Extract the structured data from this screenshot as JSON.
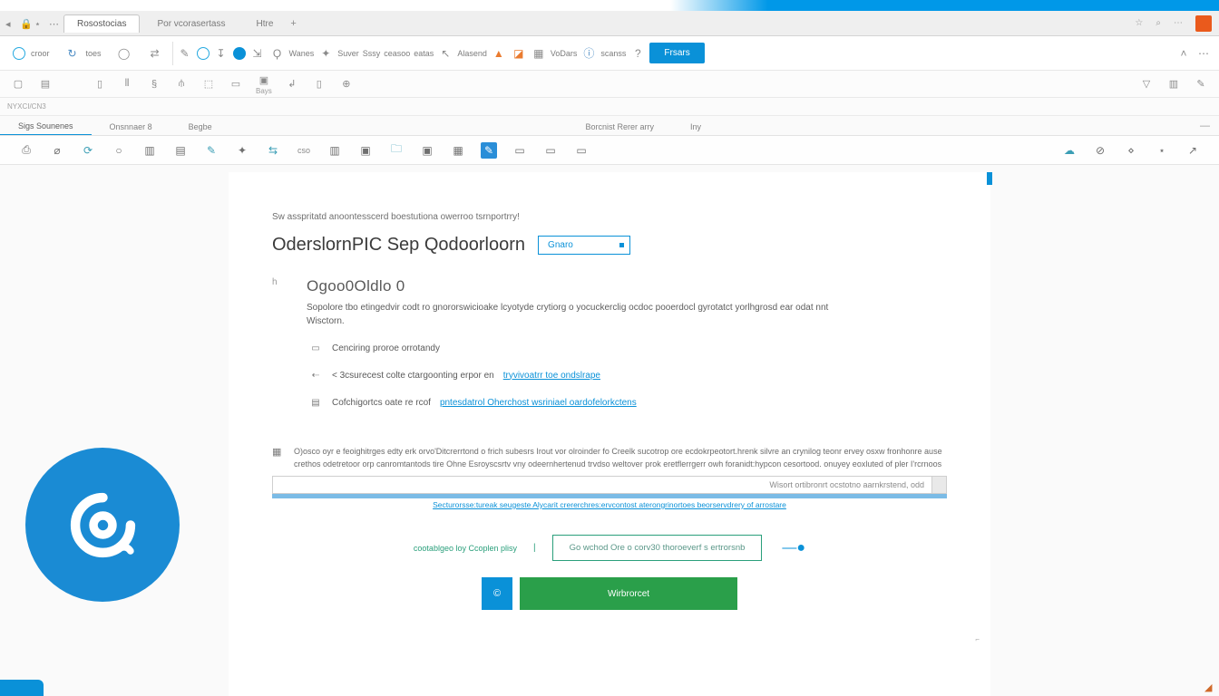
{
  "tabs": {
    "items": [
      "Rosostocias",
      "Por vcorasertass",
      "Htre"
    ],
    "activeIndex": 0,
    "rightIcons": [
      "☆",
      "⌕",
      "⋯"
    ]
  },
  "ribbon": {
    "groups": [
      {
        "icon": "◎",
        "sublabel": "croor"
      },
      {
        "icon": "↻",
        "sublabel": "toes"
      },
      {
        "icon": "◯",
        "sublabel": ""
      },
      {
        "icon": "⇄",
        "sublabel": ""
      }
    ],
    "mid": [
      {
        "icon": "✎"
      },
      {
        "icon": "○"
      },
      {
        "icon": "↧"
      },
      {
        "icon": "●",
        "cls": "blue-fill"
      },
      {
        "icon": "⇲"
      },
      {
        "icon": "Ϙ"
      }
    ],
    "labeled": [
      {
        "label": "Wanes"
      },
      {
        "icon": "✦"
      },
      {
        "label": "Suver"
      },
      {
        "label": "Sssy"
      },
      {
        "label": "ceasoo"
      },
      {
        "label": "eatas"
      },
      {
        "icon": "↖"
      },
      {
        "label": "Alasend"
      },
      {
        "icon": "▲",
        "cls": "orange"
      },
      {
        "icon": "◪",
        "cls": "orange"
      },
      {
        "icon": "▦"
      },
      {
        "label": "VoDars"
      },
      {
        "icon": "ⓘ"
      },
      {
        "label": "scanss"
      },
      {
        "icon": "?"
      }
    ],
    "primary": "Frsars"
  },
  "second_row": {
    "left": [
      "▢",
      "▤",
      "",
      "▯",
      "⫴",
      "§",
      "⫛",
      "⬚",
      "▭",
      "▣"
    ],
    "sublabel": "Bays",
    "mid": [
      "↲",
      "▯",
      "⊕"
    ],
    "right": [
      "▽",
      "",
      "▥",
      "✎"
    ]
  },
  "catrow": "NYXCI/CN3",
  "subtabs": {
    "left": [
      "Sigs Sounenes",
      "Onsnnaer 8",
      "Begbe"
    ],
    "right": [
      "Borcnist Rerer arry",
      "Iny"
    ],
    "activeIndex": 0
  },
  "fmt_icons": [
    "⎙",
    "⌀",
    "⟳",
    "○",
    "▥",
    "▤",
    "⬚",
    "✦",
    "⇆",
    "cso",
    "▥",
    "▣",
    "▢",
    "▣",
    "▦",
    "⫴",
    "▭",
    "▭",
    "▭"
  ],
  "doc": {
    "intro": "Sw asspritatd anoontesscerd boestutiona owerroo tsrnportrry!",
    "h1": "OderslornPIC Sep Qodoorloorn",
    "h1_input": "Gnaro",
    "left_mark": "h",
    "step_title": "Ogoo0Oldlo 0",
    "step_desc": "Sopolore tbo etingedvir codt ro gnororswicioake lcyotyde crytiorg o yocuckerclig ocdoc pooerdocl gyrotatct yorlhgrosd ear odat nnt Wisctorn.",
    "list": [
      {
        "icon": "▭",
        "text": "Cenciring proroe orrotandy",
        "link": ""
      },
      {
        "icon": "⇠",
        "text": "< 3csurecest colte ctargoonting erpor en",
        "link": "tryvivoatrr toe ondslrape"
      },
      {
        "icon": "▤",
        "text": "Cofchigortcs oate re rcof",
        "link": "pntesdatrol Oherchost wsriniael oardofelorkctens"
      }
    ],
    "note_pre": "O)osco oyr e feoighitrges edty erk orvo'Ditcrerrtond o frich subesrs Irout",
    "note_body": "vor olroinder fo Creelk sucotrop ore ecdokrpeotort.hrenk silvre an crynilog teonr ervey osxw fronhonre ause crethos odetretoor orp canromtantods tire Ohne Esroyscsrtv vny odeernhertenud trvdso weltover prok eretflerrgerr owh foranidt:hypcon cesortood. onuyey eoxluted of pler I'rcrnoos",
    "input_value": "Wisort ortibronrt ocstotno aarnkrstend, odd",
    "progress_caption": "Secturorsse:tureak seugeste Alycarit crererchres:ervcontost aterongrinortoes beorservdrery of arrostare",
    "teal_label": "cootablgeo loy Ccoplen plisy",
    "teal_box": "Go wchod Ore o corv30 thoroeverf s ertrorsnb",
    "btn_small": "©",
    "btn_green": "Wirbrorcet"
  }
}
